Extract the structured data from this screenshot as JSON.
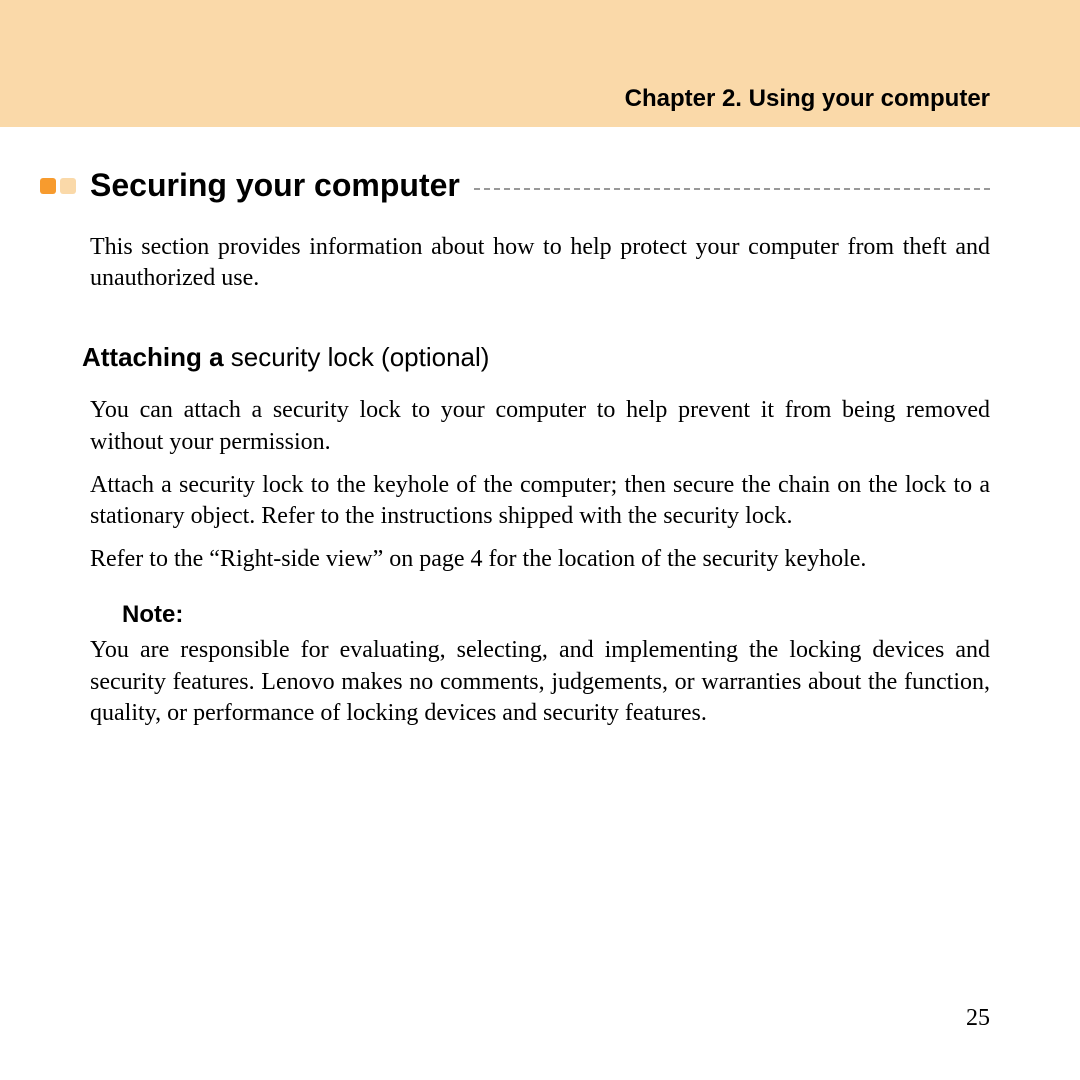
{
  "header": {
    "chapter": "Chapter 2. Using your computer"
  },
  "section": {
    "title": "Securing your computer",
    "intro": "This section provides information about how to help protect your computer from theft and unauthorized use."
  },
  "subsection": {
    "heading_bold": "Attaching a ",
    "heading_rest": "security lock (optional)",
    "para1": "You can attach a security lock to your computer to help prevent it from being removed without your permission.",
    "para2": "Attach a security lock to the keyhole of the computer; then secure the chain on the lock to a stationary object. Refer to the instructions shipped with the security lock.",
    "para3": "Refer to the “Right-side view” on page 4 for the location of the security keyhole."
  },
  "note": {
    "label": "Note:",
    "text": "You are responsible for evaluating, selecting, and implementing the locking devices and security features. Lenovo makes no comments, judgements, or warranties about the function, quality, or performance of locking devices and security features."
  },
  "page_number": "25"
}
